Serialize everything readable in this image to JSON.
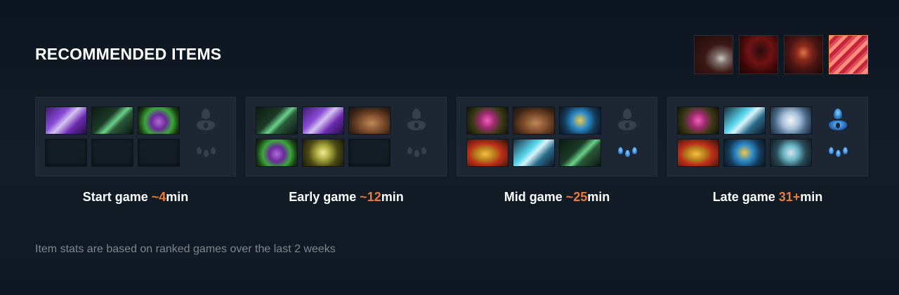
{
  "section": {
    "title": "RECOMMENDED ITEMS"
  },
  "skills": [
    {
      "icon": "hero-skill-1-icon",
      "active": false
    },
    {
      "icon": "hero-skill-2-icon",
      "active": false
    },
    {
      "icon": "hero-skill-3-icon",
      "active": false
    },
    {
      "icon": "hero-skill-4-icon",
      "active": true
    }
  ],
  "phases": [
    {
      "name": "Start game ",
      "time": "~4",
      "unit": "min",
      "items": [
        "crystal-item-icon",
        "wand-item-icon",
        "potion-item-icon",
        "",
        "",
        ""
      ],
      "neutral_active": false
    },
    {
      "name": "Early game ",
      "time": "~12",
      "unit": "min",
      "items": [
        "wand-item-icon",
        "crystal-item-icon",
        "boots-item-icon",
        "potion-item-icon",
        "vortex-item-icon",
        ""
      ],
      "neutral_active": false
    },
    {
      "name": "Mid game ",
      "time": "~25",
      "unit": "min",
      "items": [
        "orb-item-icon",
        "boots-item-icon",
        "gold-ring-item-icon",
        "golden-helm-item-icon",
        "blade-item-icon",
        "wand-item-icon"
      ],
      "neutral_active": true
    },
    {
      "name": "Late game ",
      "time": "31+",
      "unit": "min",
      "items": [
        "orb-item-icon",
        "blade-item-icon",
        "wind-item-icon",
        "golden-helm-item-icon",
        "gold-ring-item-icon",
        "skull-item-icon"
      ],
      "neutral_active": true
    }
  ],
  "footnote": "Item stats are based on ranked games over the last 2 weeks",
  "colors": {
    "accent": "#ee7a34",
    "background": "#0f1822",
    "panel": "#1c2733"
  }
}
